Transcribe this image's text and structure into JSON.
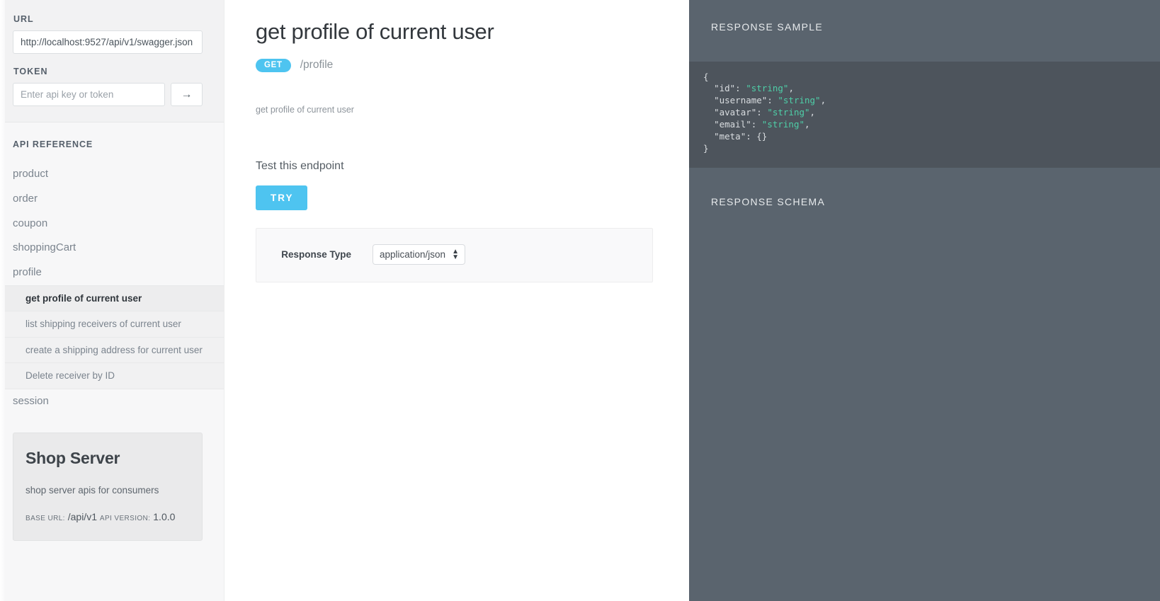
{
  "sidebar": {
    "url_label": "URL",
    "url_value": "http://localhost:9527/api/v1/swagger.json",
    "token_label": "TOKEN",
    "token_value": "",
    "token_placeholder": "Enter api key or token",
    "submit_icon": "→",
    "nav_heading": "API REFERENCE",
    "groups": [
      {
        "label": "product",
        "sub": []
      },
      {
        "label": "order",
        "sub": []
      },
      {
        "label": "coupon",
        "sub": []
      },
      {
        "label": "shoppingCart",
        "sub": []
      },
      {
        "label": "profile",
        "sub": [
          {
            "label": "get profile of current user",
            "active": true
          },
          {
            "label": "list shipping receivers of current user",
            "active": false
          },
          {
            "label": "create a shipping address for current user",
            "active": false
          },
          {
            "label": "Delete receiver by ID",
            "active": false
          }
        ]
      },
      {
        "label": "session",
        "sub": []
      }
    ],
    "info_card": {
      "title": "Shop Server",
      "description": "shop server apis for consumers",
      "base_url_key": "base url:",
      "base_url_value": "/api/v1",
      "api_version_key": "api version:",
      "api_version_value": "1.0.0"
    }
  },
  "main": {
    "title": "get profile of current user",
    "method": "GET",
    "path": "/profile",
    "description": "get profile of current user",
    "test_heading": "Test this endpoint",
    "try_label": "TRY",
    "param_label": "Response Type",
    "response_type_value": "application/json",
    "response_type_options": [
      "application/json"
    ],
    "select_arrow_icon": "⬆⬇"
  },
  "right_panel": {
    "sample_heading": "RESPONSE SAMPLE",
    "schema_heading": "RESPONSE SCHEMA",
    "code_lines": [
      {
        "indent": 0,
        "parts": [
          {
            "t": "{",
            "c": "plain"
          }
        ]
      },
      {
        "indent": 1,
        "parts": [
          {
            "t": "\"id\": ",
            "c": "key"
          },
          {
            "t": "\"string\"",
            "c": "str"
          },
          {
            "t": ",",
            "c": "plain"
          }
        ]
      },
      {
        "indent": 1,
        "parts": [
          {
            "t": "\"username\": ",
            "c": "key"
          },
          {
            "t": "\"string\"",
            "c": "str"
          },
          {
            "t": ",",
            "c": "plain"
          }
        ]
      },
      {
        "indent": 1,
        "parts": [
          {
            "t": "\"avatar\": ",
            "c": "key"
          },
          {
            "t": "\"string\"",
            "c": "str"
          },
          {
            "t": ",",
            "c": "plain"
          }
        ]
      },
      {
        "indent": 1,
        "parts": [
          {
            "t": "\"email\": ",
            "c": "key"
          },
          {
            "t": "\"string\"",
            "c": "str"
          },
          {
            "t": ",",
            "c": "plain"
          }
        ]
      },
      {
        "indent": 1,
        "parts": [
          {
            "t": "\"meta\": {}",
            "c": "key"
          }
        ]
      },
      {
        "indent": 0,
        "parts": [
          {
            "t": "}",
            "c": "plain"
          }
        ]
      }
    ]
  },
  "colors": {
    "accent": "#4ec4f0",
    "panel_bg": "#5a646e",
    "code_bg": "#4d545c",
    "code_string": "#4ecfa8",
    "sidebar_bg": "#f7f7f8"
  }
}
